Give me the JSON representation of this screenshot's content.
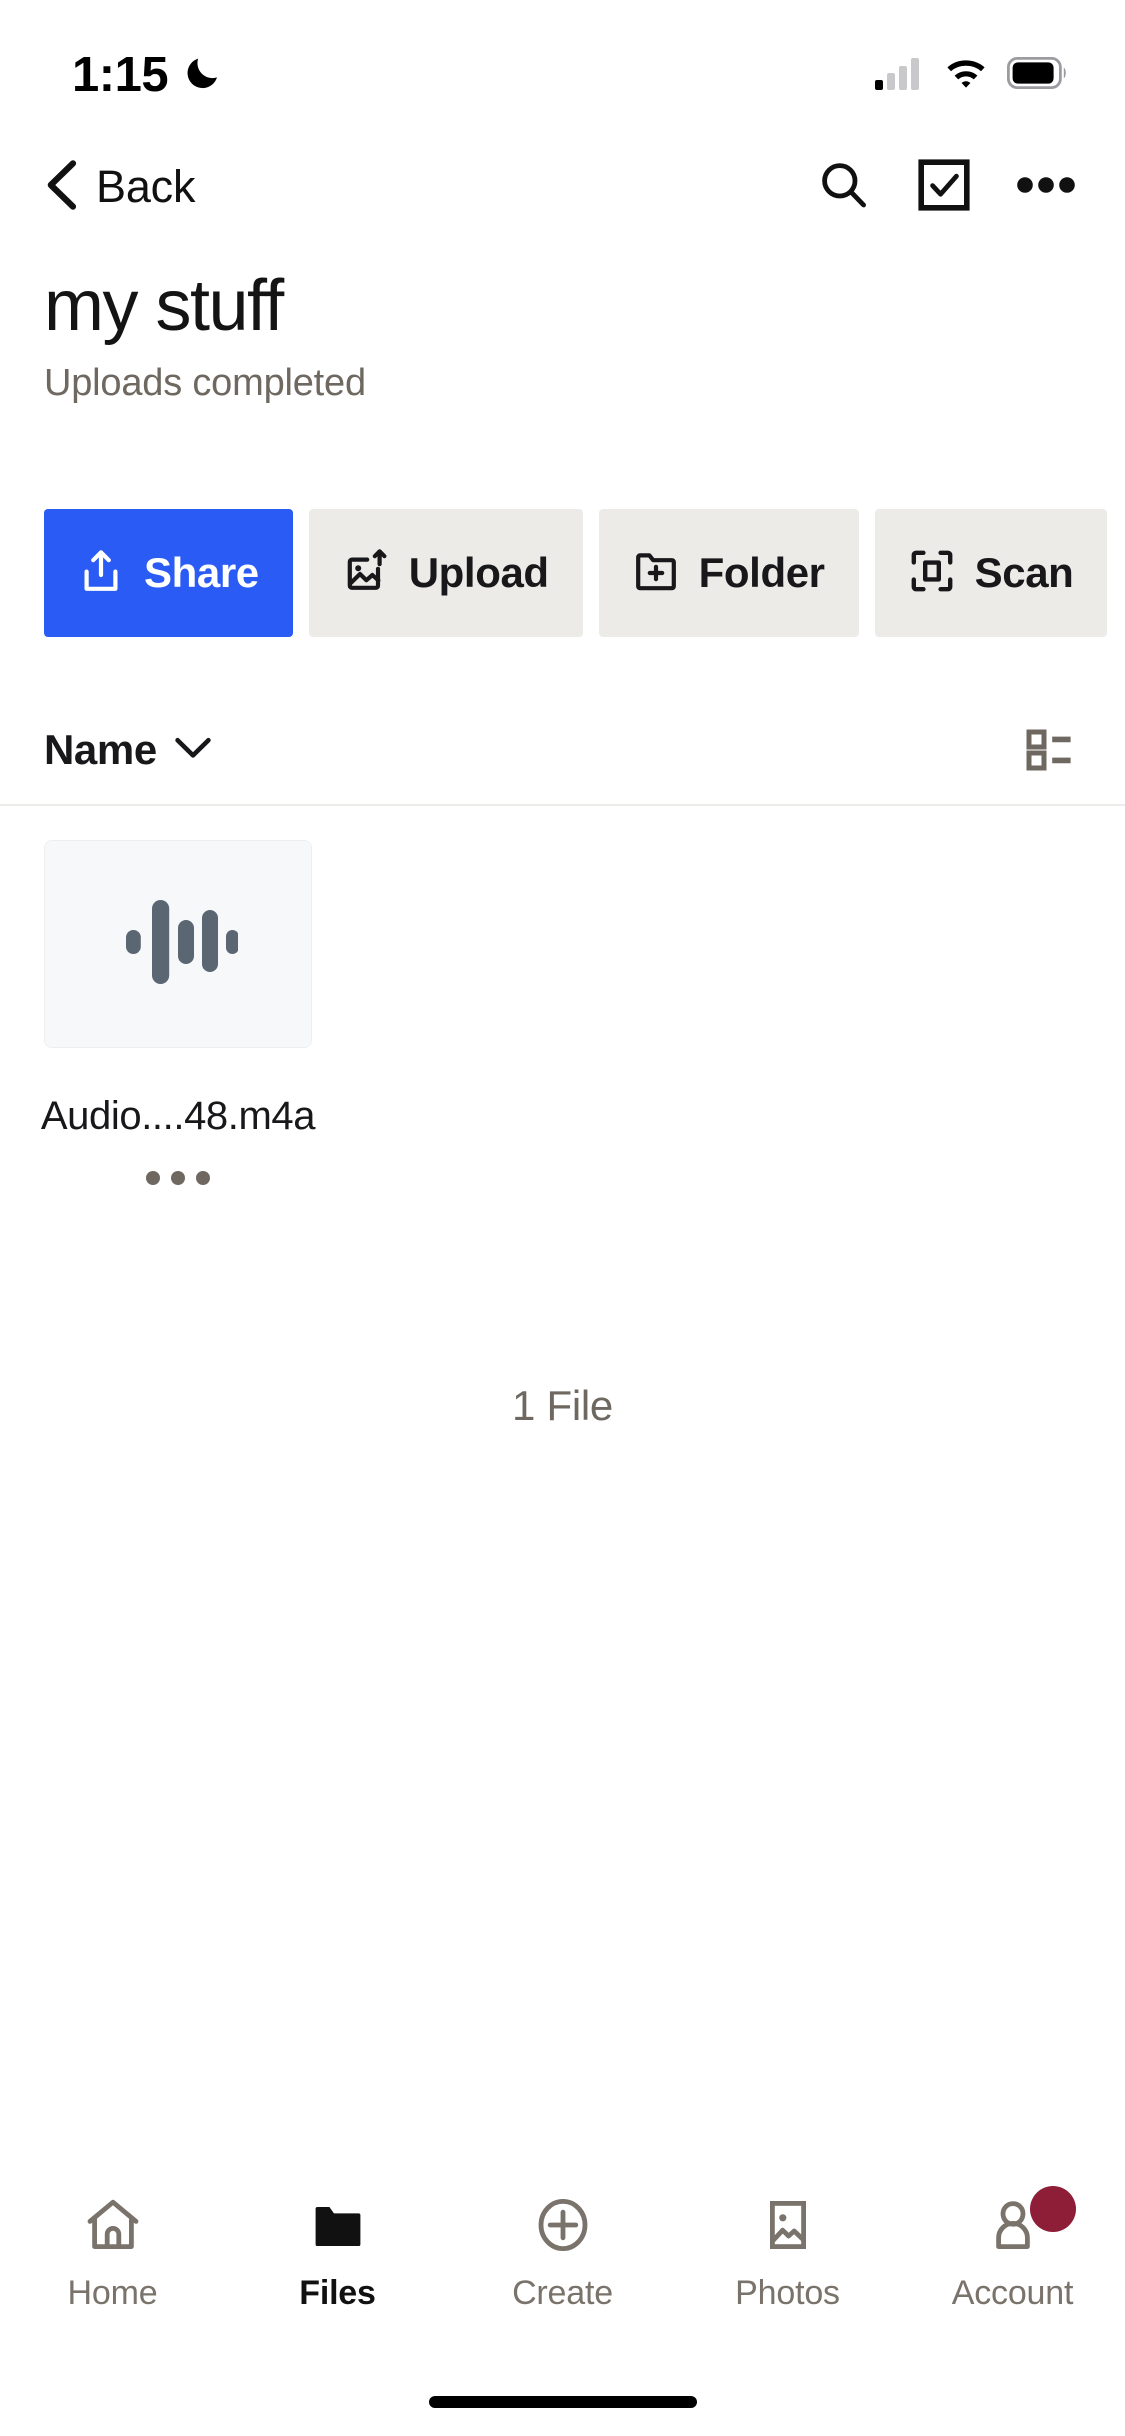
{
  "status_bar": {
    "time": "1:15",
    "dnd_icon": "crescent-moon-icon",
    "cellular_icon": "cellular-signal-icon",
    "wifi_icon": "wifi-icon",
    "battery_icon": "battery-icon"
  },
  "nav": {
    "back_label": "Back",
    "back_icon": "chevron-left-icon",
    "search_icon": "search-icon",
    "select_icon": "checkbox-select-icon",
    "more_icon": "more-horizontal-icon"
  },
  "header": {
    "title": "my stuff",
    "subtitle": "Uploads completed"
  },
  "actions": [
    {
      "label": "Share",
      "icon": "share-upload-icon",
      "primary": true
    },
    {
      "label": "Upload",
      "icon": "image-upload-icon",
      "primary": false
    },
    {
      "label": "Folder",
      "icon": "folder-plus-icon",
      "primary": false
    },
    {
      "label": "Scan",
      "icon": "scan-frame-icon",
      "primary": false
    }
  ],
  "sort": {
    "label": "Name",
    "chevron_icon": "chevron-down-icon",
    "view_toggle_icon": "list-view-icon"
  },
  "files": [
    {
      "name": "Audio....48.m4a",
      "thumb_icon": "audio-waveform-icon",
      "more_icon": "more-horizontal-icon"
    }
  ],
  "file_count": "1 File",
  "tabs": [
    {
      "label": "Home",
      "icon": "home-icon",
      "active": false,
      "badge": false
    },
    {
      "label": "Files",
      "icon": "folder-icon",
      "active": true,
      "badge": false
    },
    {
      "label": "Create",
      "icon": "plus-circle-icon",
      "active": false,
      "badge": false
    },
    {
      "label": "Photos",
      "icon": "photo-icon",
      "active": false,
      "badge": false
    },
    {
      "label": "Account",
      "icon": "person-icon",
      "active": false,
      "badge": true
    }
  ],
  "colors": {
    "accent_blue": "#2B5BF5",
    "secondary_button": "#EDEBE8",
    "muted_text": "#6E6861",
    "badge": "#8E1D38",
    "thumb_bg": "#F7F8F9",
    "waveform": "#5B6673"
  }
}
